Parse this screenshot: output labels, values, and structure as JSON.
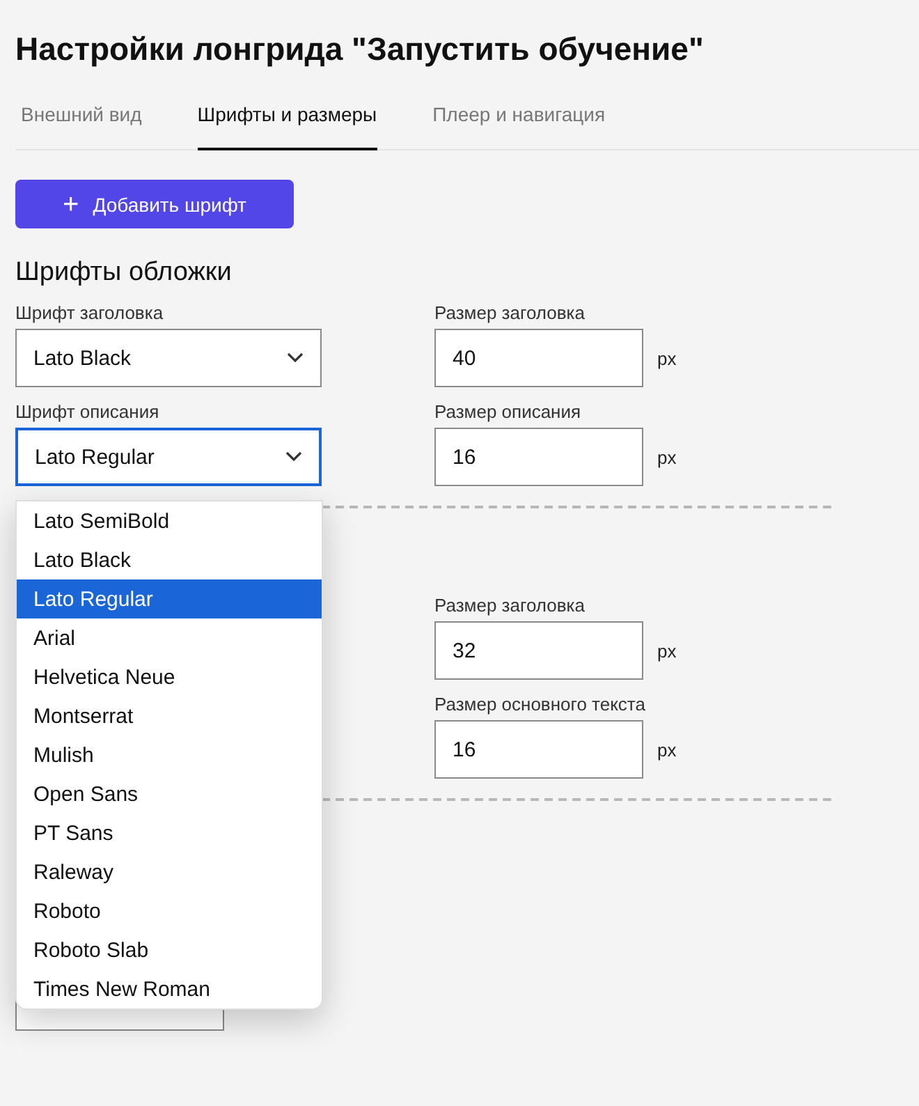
{
  "title": "Настройки лонгрида \"Запустить обучение\"",
  "tabs": [
    {
      "label": "Внешний вид",
      "selected": false
    },
    {
      "label": "Шрифты и размеры",
      "selected": true
    },
    {
      "label": "Плеер и навигация",
      "selected": false
    }
  ],
  "add_button": {
    "icon": "+",
    "label": "Добавить шрифт"
  },
  "sections": [
    {
      "kind": "full",
      "heading": "Шрифты обложки",
      "rows": [
        {
          "font": {
            "label": "Шрифт заголовка",
            "value": "Lato Black",
            "focused": false
          },
          "size": {
            "label": "Размер заголовка",
            "value": "40",
            "unit": "px"
          }
        },
        {
          "font": {
            "label": "Шрифт описания",
            "value": "Lato Regular",
            "focused": true
          },
          "size": {
            "label": "Размер описания",
            "value": "16",
            "unit": "px"
          }
        }
      ]
    },
    {
      "kind": "covered",
      "rows": [
        {
          "size": {
            "label": "Размер заголовка",
            "value": "32",
            "unit": "px"
          }
        },
        {
          "size": {
            "label": "Размер основного текста",
            "value": "16",
            "unit": "px"
          }
        }
      ]
    },
    {
      "kind": "covered_input"
    }
  ],
  "dropdown": {
    "options": [
      {
        "label": "Lato SemiBold",
        "selected": false
      },
      {
        "label": "Lato Black",
        "selected": false
      },
      {
        "label": "Lato Regular",
        "selected": true
      },
      {
        "label": "Arial",
        "selected": false
      },
      {
        "label": "Helvetica Neue",
        "selected": false
      },
      {
        "label": "Montserrat",
        "selected": false
      },
      {
        "label": "Mulish",
        "selected": false
      },
      {
        "label": "Open Sans",
        "selected": false
      },
      {
        "label": "PT Sans",
        "selected": false
      },
      {
        "label": "Raleway",
        "selected": false
      },
      {
        "label": "Roboto",
        "selected": false
      },
      {
        "label": "Roboto Slab",
        "selected": false
      },
      {
        "label": "Times New Roman",
        "selected": false
      }
    ]
  }
}
